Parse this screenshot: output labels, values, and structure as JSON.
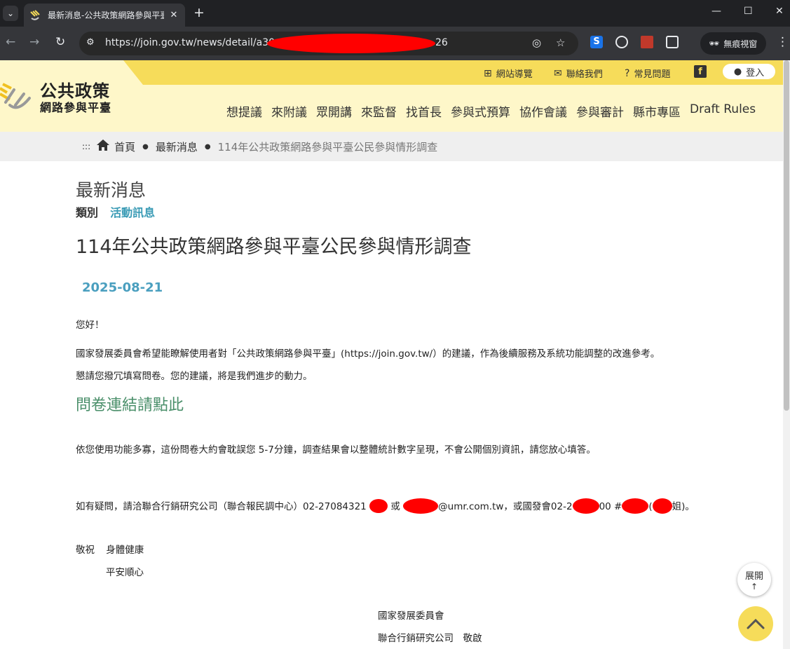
{
  "browser": {
    "tab_title": "最新消息-公共政策網路參與平臺",
    "tab_close": "✕",
    "new_tab": "+",
    "url": "https://join.gov.tw/news/detail/a30",
    "url_tail": "26",
    "incognito_label": "無痕視窗"
  },
  "header": {
    "logo_title": "公共政策",
    "logo_subtitle": "網路參與平臺",
    "top_links": {
      "sitemap": "網站導覽",
      "contact": "聯絡我們",
      "faq": "常見問題",
      "login": "登入"
    },
    "nav": [
      "想提議",
      "來附議",
      "眾開講",
      "來監督",
      "找首長",
      "參與式預算",
      "協作會議",
      "參與審計",
      "縣市專區",
      "Draft Rules"
    ]
  },
  "breadcrumb": {
    "prefix": ":::",
    "home": "首頁",
    "section": "最新消息",
    "current": "114年公共政策網路參與平臺公民參與情形調查"
  },
  "article": {
    "section_title": "最新消息",
    "category_label": "類別",
    "category_value": "活動訊息",
    "title": "114年公共政策網路參與平臺公民參與情形調查",
    "date": "2025-08-21",
    "greeting": "您好！",
    "para1": "國家發展委員會希望能瞭解使用者對「公共政策網路參與平臺」(https://join.gov.tw/）的建議，作為後續服務及系統功能調整的改進參考。",
    "para2": "懇請您撥冗填寫問卷。您的建議，將是我們進步的動力。",
    "survey_link": "問卷連結請點此",
    "para3": "依您使用功能多寡，這份問卷大約會耽誤您 5-7分鐘，調查結果會以整體統計數字呈現，不會公開個別資訊，請您放心填答。",
    "contact_a": "如有疑問，請洽聯合行銷研究公司（聯合報民調中心）02-27084321",
    "contact_b": "或",
    "contact_c": "@umr.com.tw，或國發會02-2",
    "contact_d": "00 #",
    "contact_e": "(",
    "contact_f": "姐)。",
    "regards": "敬祝",
    "wish1": "身體健康",
    "wish2": "平安順心",
    "org1": "國家發展委員會",
    "org2": "聯合行銷研究公司　敬啟"
  },
  "widgets": {
    "expand_label": "展開"
  }
}
